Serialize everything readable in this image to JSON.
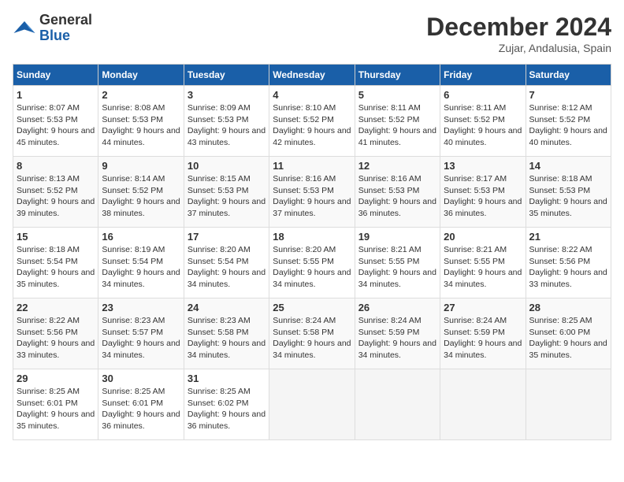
{
  "logo": {
    "general": "General",
    "blue": "Blue"
  },
  "title": "December 2024",
  "location": "Zujar, Andalusia, Spain",
  "headers": [
    "Sunday",
    "Monday",
    "Tuesday",
    "Wednesday",
    "Thursday",
    "Friday",
    "Saturday"
  ],
  "weeks": [
    [
      {
        "day": "1",
        "sunrise": "8:07 AM",
        "sunset": "5:53 PM",
        "daylight": "9 hours and 45 minutes."
      },
      {
        "day": "2",
        "sunrise": "8:08 AM",
        "sunset": "5:53 PM",
        "daylight": "9 hours and 44 minutes."
      },
      {
        "day": "3",
        "sunrise": "8:09 AM",
        "sunset": "5:53 PM",
        "daylight": "9 hours and 43 minutes."
      },
      {
        "day": "4",
        "sunrise": "8:10 AM",
        "sunset": "5:52 PM",
        "daylight": "9 hours and 42 minutes."
      },
      {
        "day": "5",
        "sunrise": "8:11 AM",
        "sunset": "5:52 PM",
        "daylight": "9 hours and 41 minutes."
      },
      {
        "day": "6",
        "sunrise": "8:11 AM",
        "sunset": "5:52 PM",
        "daylight": "9 hours and 40 minutes."
      },
      {
        "day": "7",
        "sunrise": "8:12 AM",
        "sunset": "5:52 PM",
        "daylight": "9 hours and 40 minutes."
      }
    ],
    [
      {
        "day": "8",
        "sunrise": "8:13 AM",
        "sunset": "5:52 PM",
        "daylight": "9 hours and 39 minutes."
      },
      {
        "day": "9",
        "sunrise": "8:14 AM",
        "sunset": "5:52 PM",
        "daylight": "9 hours and 38 minutes."
      },
      {
        "day": "10",
        "sunrise": "8:15 AM",
        "sunset": "5:53 PM",
        "daylight": "9 hours and 37 minutes."
      },
      {
        "day": "11",
        "sunrise": "8:16 AM",
        "sunset": "5:53 PM",
        "daylight": "9 hours and 37 minutes."
      },
      {
        "day": "12",
        "sunrise": "8:16 AM",
        "sunset": "5:53 PM",
        "daylight": "9 hours and 36 minutes."
      },
      {
        "day": "13",
        "sunrise": "8:17 AM",
        "sunset": "5:53 PM",
        "daylight": "9 hours and 36 minutes."
      },
      {
        "day": "14",
        "sunrise": "8:18 AM",
        "sunset": "5:53 PM",
        "daylight": "9 hours and 35 minutes."
      }
    ],
    [
      {
        "day": "15",
        "sunrise": "8:18 AM",
        "sunset": "5:54 PM",
        "daylight": "9 hours and 35 minutes."
      },
      {
        "day": "16",
        "sunrise": "8:19 AM",
        "sunset": "5:54 PM",
        "daylight": "9 hours and 34 minutes."
      },
      {
        "day": "17",
        "sunrise": "8:20 AM",
        "sunset": "5:54 PM",
        "daylight": "9 hours and 34 minutes."
      },
      {
        "day": "18",
        "sunrise": "8:20 AM",
        "sunset": "5:55 PM",
        "daylight": "9 hours and 34 minutes."
      },
      {
        "day": "19",
        "sunrise": "8:21 AM",
        "sunset": "5:55 PM",
        "daylight": "9 hours and 34 minutes."
      },
      {
        "day": "20",
        "sunrise": "8:21 AM",
        "sunset": "5:55 PM",
        "daylight": "9 hours and 34 minutes."
      },
      {
        "day": "21",
        "sunrise": "8:22 AM",
        "sunset": "5:56 PM",
        "daylight": "9 hours and 33 minutes."
      }
    ],
    [
      {
        "day": "22",
        "sunrise": "8:22 AM",
        "sunset": "5:56 PM",
        "daylight": "9 hours and 33 minutes."
      },
      {
        "day": "23",
        "sunrise": "8:23 AM",
        "sunset": "5:57 PM",
        "daylight": "9 hours and 34 minutes."
      },
      {
        "day": "24",
        "sunrise": "8:23 AM",
        "sunset": "5:58 PM",
        "daylight": "9 hours and 34 minutes."
      },
      {
        "day": "25",
        "sunrise": "8:24 AM",
        "sunset": "5:58 PM",
        "daylight": "9 hours and 34 minutes."
      },
      {
        "day": "26",
        "sunrise": "8:24 AM",
        "sunset": "5:59 PM",
        "daylight": "9 hours and 34 minutes."
      },
      {
        "day": "27",
        "sunrise": "8:24 AM",
        "sunset": "5:59 PM",
        "daylight": "9 hours and 34 minutes."
      },
      {
        "day": "28",
        "sunrise": "8:25 AM",
        "sunset": "6:00 PM",
        "daylight": "9 hours and 35 minutes."
      }
    ],
    [
      {
        "day": "29",
        "sunrise": "8:25 AM",
        "sunset": "6:01 PM",
        "daylight": "9 hours and 35 minutes."
      },
      {
        "day": "30",
        "sunrise": "8:25 AM",
        "sunset": "6:01 PM",
        "daylight": "9 hours and 36 minutes."
      },
      {
        "day": "31",
        "sunrise": "8:25 AM",
        "sunset": "6:02 PM",
        "daylight": "9 hours and 36 minutes."
      },
      null,
      null,
      null,
      null
    ]
  ]
}
